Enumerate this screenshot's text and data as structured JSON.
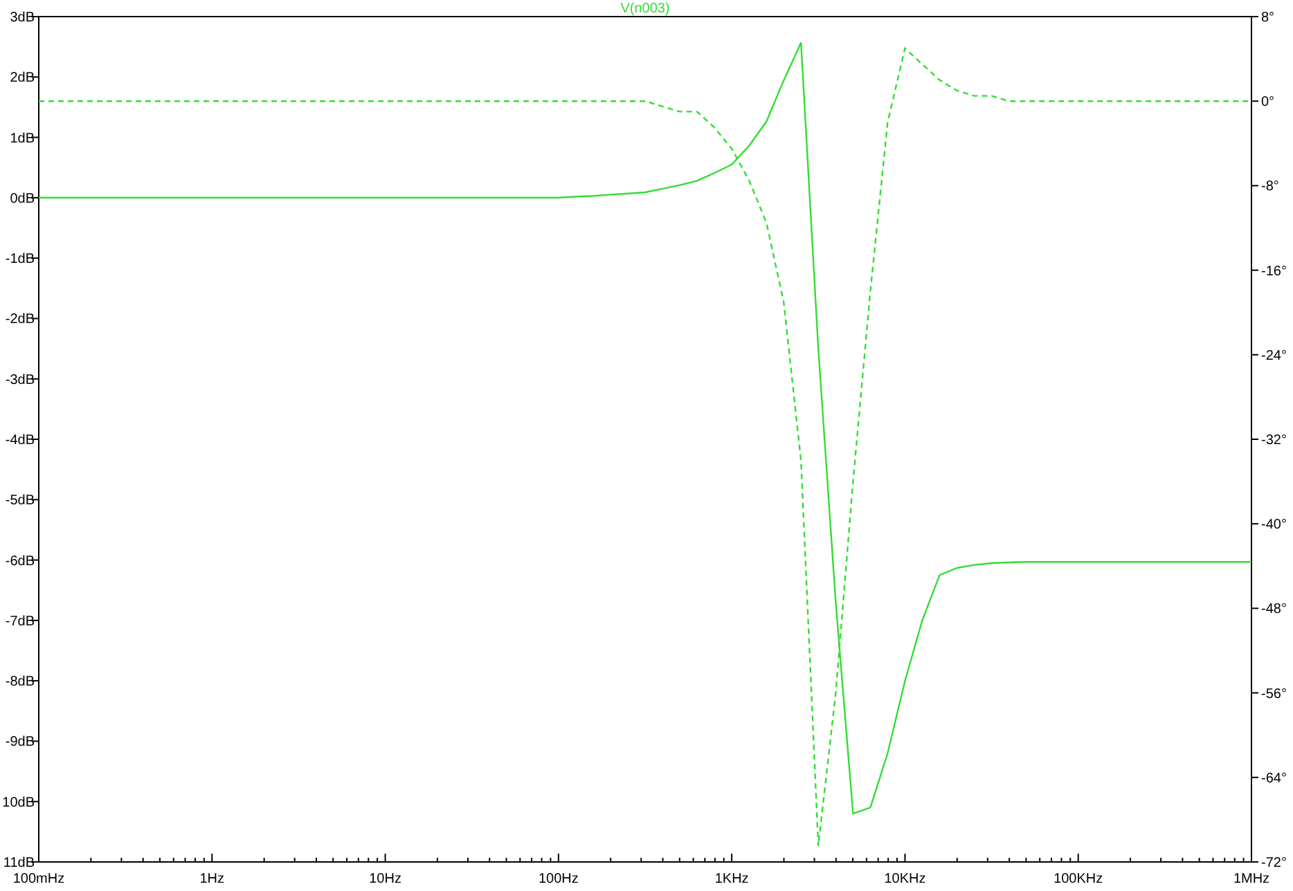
{
  "chart": {
    "chart_data": {
      "type": "line",
      "title": "V(n003)",
      "categories": [
        "100mHz",
        null,
        null,
        null,
        null,
        null,
        null,
        null,
        null,
        null,
        "1Hz",
        null,
        null,
        null,
        null,
        null,
        null,
        null,
        null,
        null,
        "10Hz",
        null,
        null,
        null,
        null,
        null,
        null,
        null,
        null,
        null,
        "100Hz",
        null,
        null,
        null,
        null,
        null,
        null,
        null,
        null,
        null,
        "1KHz",
        null,
        null,
        null,
        null,
        null,
        null,
        null,
        null,
        null,
        "10KHz",
        null,
        null,
        null,
        null,
        null,
        null,
        null,
        null,
        null,
        "100KHz",
        null,
        null,
        null,
        null,
        null,
        null,
        null,
        null,
        null,
        "1MHz"
      ],
      "ylim": [
        -11,
        3
      ],
      "y2lim": [
        -72,
        8
      ],
      "yticks": [
        {
          "value": 3,
          "label": "3dB"
        },
        {
          "value": 2,
          "label": "2dB"
        },
        {
          "value": 1,
          "label": "1dB"
        },
        {
          "value": 0,
          "label": "0dB"
        },
        {
          "value": -1,
          "label": "-1dB"
        },
        {
          "value": -2,
          "label": "-2dB"
        },
        {
          "value": -3,
          "label": "-3dB"
        },
        {
          "value": -4,
          "label": "-4dB"
        },
        {
          "value": -5,
          "label": "-5dB"
        },
        {
          "value": -6,
          "label": "-6dB"
        },
        {
          "value": -7,
          "label": "-7dB"
        },
        {
          "value": -8,
          "label": "-8dB"
        },
        {
          "value": -9,
          "label": "-9dB"
        },
        {
          "value": -10,
          "label": "10dB"
        },
        {
          "value": -11,
          "label": "11dB"
        }
      ],
      "y2ticks": [
        {
          "value": 8,
          "label": "8°"
        },
        {
          "value": 0,
          "label": "0°"
        },
        {
          "value": -8,
          "label": "-8°"
        },
        {
          "value": -16,
          "label": "-16°"
        },
        {
          "value": -24,
          "label": "-24°"
        },
        {
          "value": -32,
          "label": "-32°"
        },
        {
          "value": -40,
          "label": "-40°"
        },
        {
          "value": -48,
          "label": "-48°"
        },
        {
          "value": -56,
          "label": "-56°"
        },
        {
          "value": -64,
          "label": "-64°"
        },
        {
          "value": -72,
          "label": "-72°"
        }
      ],
      "series": [
        {
          "color": "#33dd33",
          "line_style": "solid",
          "values": [
            0,
            0,
            0,
            0,
            0,
            0,
            0,
            0,
            0,
            0,
            0,
            0,
            0,
            0,
            0,
            0,
            0,
            0,
            0,
            0,
            0,
            0,
            0,
            0,
            0,
            0,
            0,
            0,
            0,
            0,
            0,
            0.02,
            0.03,
            0.05,
            0.07,
            0.09,
            0.15,
            0.21,
            0.28,
            0.41,
            0.55,
            0.86,
            1.26,
            1.94,
            2.57,
            -2.5,
            -6.7,
            -10.2,
            -10.1,
            -9.2,
            -8,
            -7,
            -6.25,
            -6.13,
            -6.08,
            -6.05,
            -6.04,
            -6.03,
            -6.03,
            -6.03,
            -6.03,
            -6.03,
            -6.03,
            -6.03,
            -6.03,
            -6.03,
            -6.03,
            -6.03,
            -6.03,
            -6.03,
            -6.03
          ]
        },
        {
          "color": "#33dd33",
          "axis": "y2",
          "line_style": "dashed",
          "values": [
            0,
            0,
            0,
            0,
            0,
            0,
            0,
            0,
            0,
            0,
            0,
            0,
            0,
            0,
            0,
            0,
            0,
            0,
            0,
            0,
            0,
            0,
            0,
            0,
            0,
            0,
            0,
            0,
            0,
            0,
            0,
            0,
            0,
            0,
            0,
            0,
            -0.5,
            -1,
            -1,
            -2.5,
            -4.5,
            -7.5,
            -11.5,
            -19,
            -34,
            -70.5,
            -56,
            -36,
            -18,
            -2,
            5,
            3.5,
            2,
            1,
            0.5,
            0.5,
            0,
            0,
            0,
            0,
            0,
            0,
            0,
            0,
            0,
            0,
            0,
            0,
            0,
            0,
            0
          ]
        }
      ]
    }
  }
}
